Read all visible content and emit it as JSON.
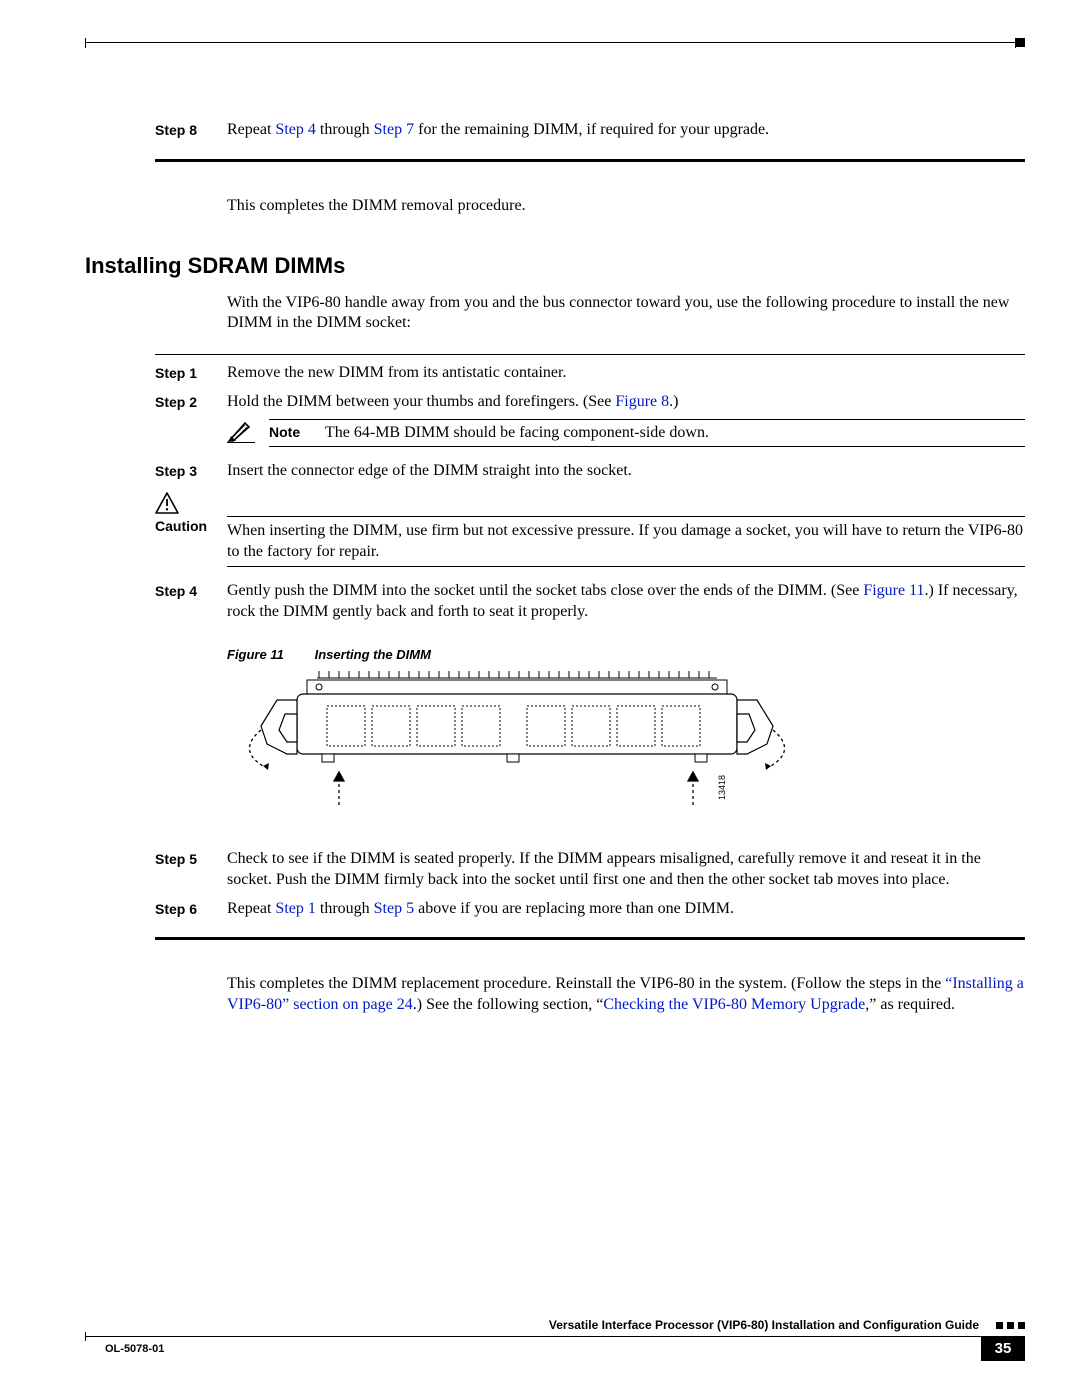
{
  "top_section": {
    "step8": {
      "label": "Step 8",
      "pre": "Repeat ",
      "link1": "Step 4",
      "mid": " through ",
      "link2": "Step 7",
      "post": " for the remaining DIMM, if required for your upgrade."
    },
    "closing": "This completes the DIMM removal procedure."
  },
  "heading": "Installing SDRAM DIMMs",
  "intro": "With the VIP6-80 handle away from you and the bus connector toward you, use the following procedure to install the new DIMM in the DIMM socket:",
  "steps": {
    "s1": {
      "label": "Step 1",
      "text": "Remove the new DIMM from its antistatic container."
    },
    "s2": {
      "label": "Step 2",
      "pre": "Hold the DIMM between your thumbs and forefingers. (See ",
      "link": "Figure 8",
      "post": ".)"
    },
    "note": {
      "label": "Note",
      "text": "The 64-MB DIMM should be facing component-side down."
    },
    "s3": {
      "label": "Step 3",
      "text": "Insert the connector edge of the DIMM straight into the socket."
    },
    "caution": {
      "label": "Caution",
      "text": "When inserting the DIMM, use firm but not excessive pressure. If you damage a socket, you will have to return the VIP6-80 to the factory for repair."
    },
    "s4": {
      "label": "Step 4",
      "pre": "Gently push the DIMM into the socket until the socket tabs close over the ends of the DIMM. (See ",
      "link": "Figure 11",
      "post": ".) If necessary, rock the DIMM gently back and forth to seat it properly."
    },
    "s5": {
      "label": "Step 5",
      "text": "Check to see if the DIMM is seated properly. If the DIMM appears misaligned, carefully remove it and reseat it in the socket. Push the DIMM firmly back into the socket until first one and then the other socket tab moves into place."
    },
    "s6": {
      "label": "Step 6",
      "pre": "Repeat ",
      "link1": "Step 1",
      "mid": " through ",
      "link2": "Step 5",
      "post": " above if you are replacing more than one DIMM."
    }
  },
  "figure": {
    "number": "Figure 11",
    "title": "Inserting the DIMM",
    "id": "13418"
  },
  "closing_para": {
    "pre": "This completes the DIMM replacement procedure. Reinstall the VIP6-80 in the system. (Follow the steps in the ",
    "link1": "“Installing a VIP6-80” section on page 24",
    "mid": ".) See the following section, “",
    "link2": "Checking the VIP6-80 Memory Upgrade",
    "post": ",” as required."
  },
  "footer": {
    "guide": "Versatile Interface Processor (VIP6-80) Installation and Configuration Guide",
    "doc_id": "OL-5078-01",
    "page": "35"
  }
}
